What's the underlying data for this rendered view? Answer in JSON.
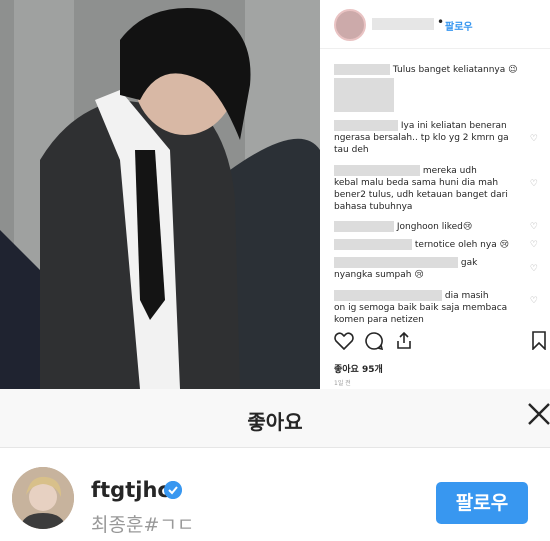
{
  "post": {
    "header": {
      "dot": "•",
      "follow_label": "팔로우"
    },
    "comments": [
      {
        "text": "Tulus banget keliatannya 😉"
      },
      {
        "text": "Iya ini keliatan beneran"
      },
      {
        "text": "ngerasa bersalah.. tp klo yg 2 kmrn ga"
      },
      {
        "text": "tau deh"
      },
      {
        "text": "mereka udh"
      },
      {
        "text": "kebal malu beda sama huni dia mah"
      },
      {
        "text": "bener2 tulus, udh ketauan banget dari"
      },
      {
        "text": "bahasa tubuhnya"
      },
      {
        "text": "Jonghoon liked😢"
      },
      {
        "text": "ternotice oleh nya 😢"
      },
      {
        "text": "gak"
      },
      {
        "text": "nyangka sumpah 😢"
      },
      {
        "text": "dia masih"
      },
      {
        "text": "on ig semoga baik baik saja membaca"
      },
      {
        "text": "komen para netizen"
      }
    ],
    "likes": "좋아요 95개",
    "time": "1일 전",
    "heart_glyph": "♡"
  },
  "modal": {
    "title": "좋아요",
    "user": {
      "username": "ftgtjhc",
      "fullname": "최종훈#ㄱㄷ",
      "follow_label": "팔로우"
    }
  },
  "colors": {
    "accent": "#3897f0",
    "text": "#262626",
    "muted": "#999999"
  },
  "icons": [
    "heart-icon",
    "comment-icon",
    "share-icon",
    "bookmark-icon",
    "close-icon",
    "verified-icon"
  ]
}
